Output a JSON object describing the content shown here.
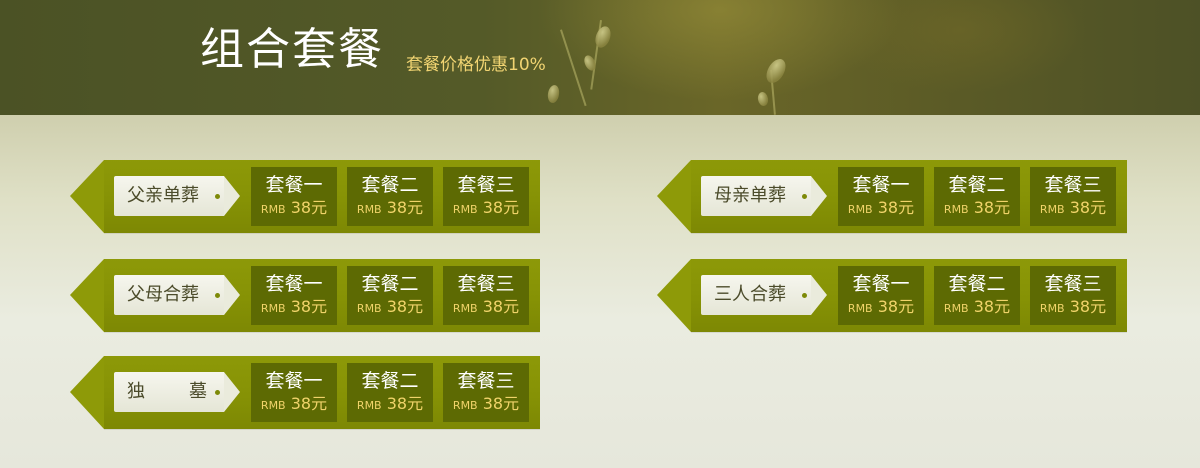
{
  "header": {
    "title": "组合套餐",
    "subtitle": "套餐价格优惠10%"
  },
  "rows": [
    {
      "label": "父亲单葬",
      "packages": [
        {
          "name": "套餐一",
          "currency": "RMB",
          "price": "38元"
        },
        {
          "name": "套餐二",
          "currency": "RMB",
          "price": "38元"
        },
        {
          "name": "套餐三",
          "currency": "RMB",
          "price": "38元"
        }
      ]
    },
    {
      "label": "母亲单葬",
      "packages": [
        {
          "name": "套餐一",
          "currency": "RMB",
          "price": "38元"
        },
        {
          "name": "套餐二",
          "currency": "RMB",
          "price": "38元"
        },
        {
          "name": "套餐三",
          "currency": "RMB",
          "price": "38元"
        }
      ]
    },
    {
      "label": "父母合葬",
      "packages": [
        {
          "name": "套餐一",
          "currency": "RMB",
          "price": "38元"
        },
        {
          "name": "套餐二",
          "currency": "RMB",
          "price": "38元"
        },
        {
          "name": "套餐三",
          "currency": "RMB",
          "price": "38元"
        }
      ]
    },
    {
      "label": "三人合葬",
      "packages": [
        {
          "name": "套餐一",
          "currency": "RMB",
          "price": "38元"
        },
        {
          "name": "套餐二",
          "currency": "RMB",
          "price": "38元"
        },
        {
          "name": "套餐三",
          "currency": "RMB",
          "price": "38元"
        }
      ]
    },
    {
      "label": "独　　墓",
      "label_parts": [
        "独",
        "墓"
      ],
      "packages": [
        {
          "name": "套餐一",
          "currency": "RMB",
          "price": "38元"
        },
        {
          "name": "套餐二",
          "currency": "RMB",
          "price": "38元"
        },
        {
          "name": "套餐三",
          "currency": "RMB",
          "price": "38元"
        }
      ]
    }
  ],
  "colors": {
    "banner": "#545a28",
    "bar": "#8a9607",
    "package_box": "#5d6a03",
    "price_text": "#f0d36a",
    "subtitle_text": "#f1d472"
  }
}
